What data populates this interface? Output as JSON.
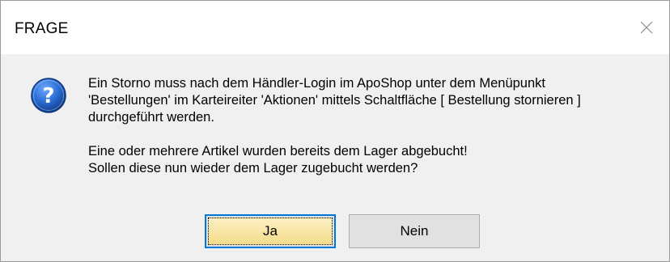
{
  "window": {
    "title": "FRAGE",
    "close_icon": "close-icon"
  },
  "message": {
    "icon": "question-icon",
    "line1": "Ein Storno muss nach dem Händler-Login im ApoShop unter dem Menüpunkt",
    "line2": "'Bestellungen' im Karteireiter 'Aktionen' mittels Schaltfläche [ Bestellung stornieren ]",
    "line3": "durchgeführt werden.",
    "line4": "Eine oder mehrere Artikel wurden bereits dem Lager abgebucht!",
    "line5": "Sollen diese nun wieder dem Lager zugebucht werden?"
  },
  "buttons": {
    "yes_label": "Ja",
    "no_label": "Nein"
  },
  "colors": {
    "icon_blue": "#1f5fbf",
    "focus_border": "#0078d7",
    "content_bg": "#f0f0f0"
  }
}
